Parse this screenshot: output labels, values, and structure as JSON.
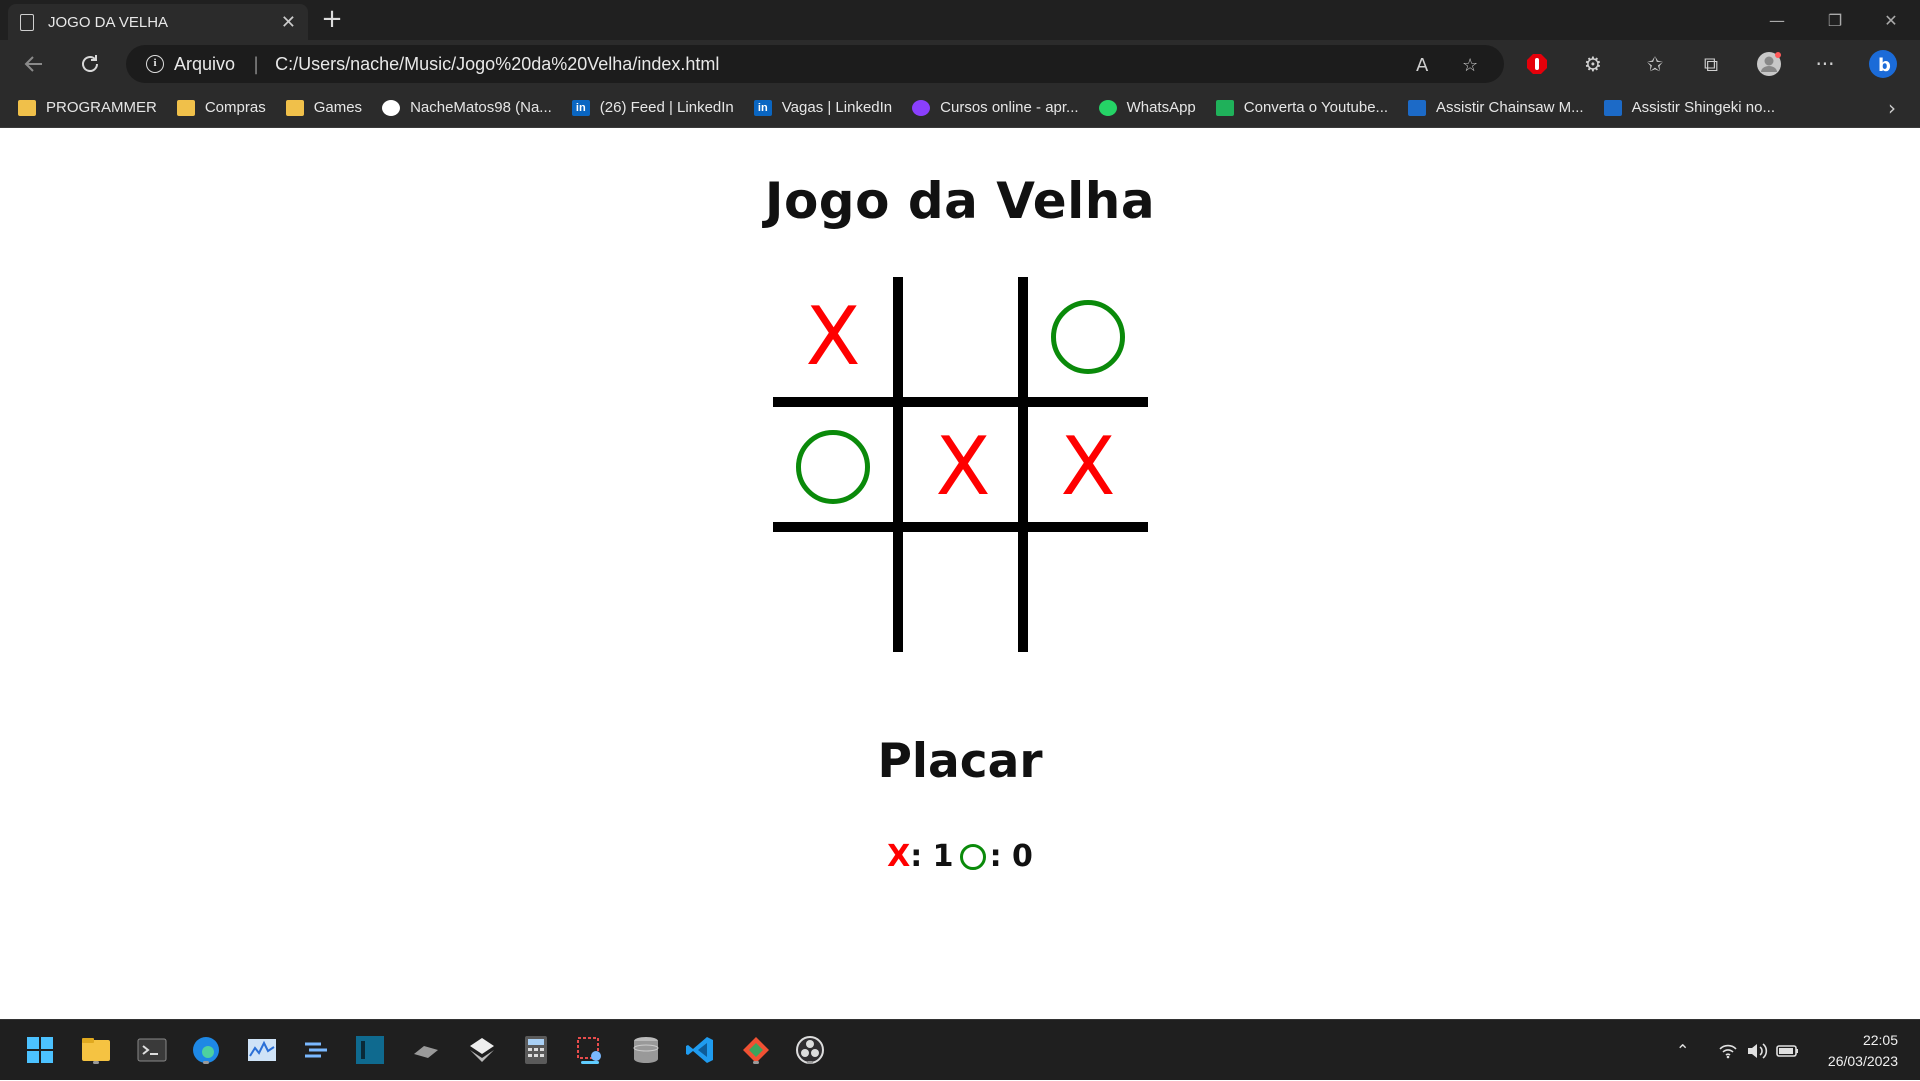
{
  "browser": {
    "tab_title": "JOGO DA VELHA",
    "address": {
      "site_label": "Arquivo",
      "url": "C:/Users/nache/Music/Jogo%20da%20Velha/index.html"
    },
    "bookmarks": [
      {
        "label": "PROGRAMMER",
        "icon": "folder-icon"
      },
      {
        "label": "Compras",
        "icon": "folder-icon"
      },
      {
        "label": "Games",
        "icon": "folder-icon"
      },
      {
        "label": "NacheMatos98 (Na...",
        "icon": "github-icon"
      },
      {
        "label": "(26) Feed | LinkedIn",
        "icon": "linkedin-icon"
      },
      {
        "label": "Vagas | LinkedIn",
        "icon": "linkedin-icon"
      },
      {
        "label": "Cursos online - apr...",
        "icon": "udemy-icon"
      },
      {
        "label": "WhatsApp",
        "icon": "whatsapp-icon"
      },
      {
        "label": "Converta o Youtube...",
        "icon": "download-icon"
      },
      {
        "label": "Assistir Chainsaw M...",
        "icon": "crunchyroll-icon"
      },
      {
        "label": "Assistir Shingeki no...",
        "icon": "crunchyroll-icon"
      }
    ],
    "linkedin_glyph": "in"
  },
  "game": {
    "title": "Jogo da Velha",
    "board": [
      "X",
      "",
      "O",
      "O",
      "X",
      "X",
      "",
      "",
      ""
    ],
    "x_color": "#ff0000",
    "o_color": "#0a8a0a",
    "score_title": "Placar",
    "score": {
      "x_label": "X",
      "x_value": ": 1",
      "o_value": ": 0"
    }
  },
  "taskbar": {
    "time": "22:05",
    "date": "26/03/2023",
    "apps": [
      "start-icon",
      "file-explorer-icon",
      "terminal-icon",
      "edge-icon",
      "resource-monitor-icon",
      "dev-tool-icon",
      "ide-icon",
      "app-icon",
      "unity-icon",
      "calculator-icon",
      "snipping-tool-icon",
      "database-icon",
      "vscode-icon",
      "git-icon",
      "obs-icon"
    ]
  }
}
